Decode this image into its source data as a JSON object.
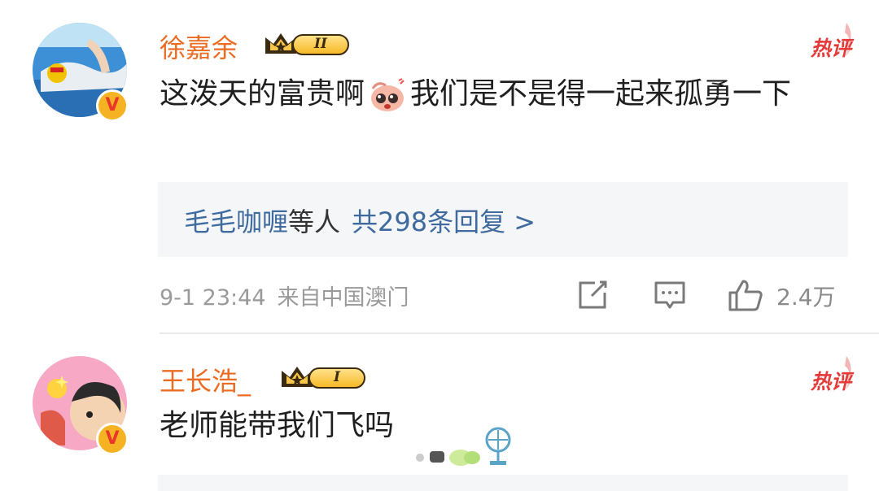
{
  "comments": [
    {
      "username": "徐嘉余",
      "rank_level": "II",
      "hot_label": "热评",
      "text_before_emoji": "这泼天的富贵啊",
      "text_after_emoji": "我们是不是得一起来孤勇一下",
      "replies": {
        "names": "毛毛咖喱",
        "connector": "等人",
        "count": "共298条回复 >"
      },
      "timestamp": "9-1 23:44",
      "location": "来自中国澳门",
      "likes": "2.4万"
    },
    {
      "username": "王长浩_",
      "rank_level": "I",
      "hot_label": "热评",
      "text": "老师能带我们飞吗"
    }
  ],
  "icons": [
    "share-icon",
    "comment-icon",
    "like-icon",
    "verified-badge-icon",
    "crown-icon"
  ],
  "colors": {
    "username": "#ea6b22",
    "hot": "#e53a3a",
    "reply_link": "#3e6a9e",
    "reply_bg": "#f5f6f8",
    "meta": "#9a9a9a"
  }
}
